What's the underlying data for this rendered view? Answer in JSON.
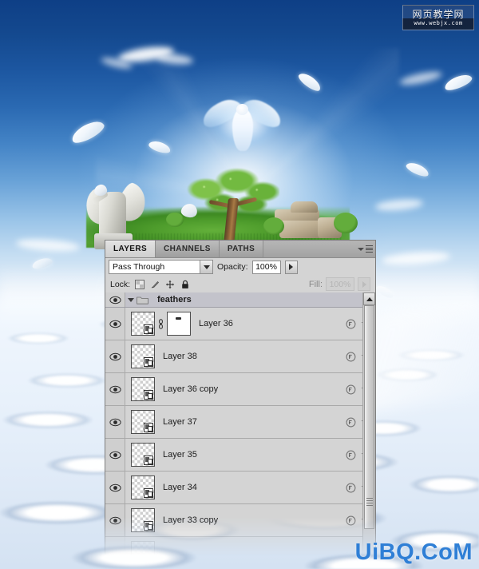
{
  "artwork": {
    "description": "Photo composite: blue sky, glowing white dove, floating feathers, angel statue, bonsai tree, stone ruins, sea of clouds",
    "sky_top_color": "#0e3f86",
    "cloud_color": "#eef5fd",
    "grass_color": "#4f9a2c"
  },
  "panel": {
    "tabs": [
      {
        "label": "LAYERS",
        "active": true
      },
      {
        "label": "CHANNELS",
        "active": false
      },
      {
        "label": "PATHS",
        "active": false
      }
    ],
    "menu_icon": "panel-menu-icon",
    "blend_mode": "Pass Through",
    "blend_dropdown_icon": "chevron-down-icon",
    "opacity_label": "Opacity:",
    "opacity_value": "100%",
    "opacity_spinner_icon": "triangle-right-icon",
    "lock_label": "Lock:",
    "lock_buttons": [
      {
        "name": "lock-transparent-pixels",
        "icon": "checkerboard-icon"
      },
      {
        "name": "lock-image-pixels",
        "icon": "brush-icon"
      },
      {
        "name": "lock-position",
        "icon": "move-icon"
      },
      {
        "name": "lock-all",
        "icon": "lock-icon"
      }
    ],
    "fill_label": "Fill:",
    "fill_value": "100%",
    "fill_disabled": true,
    "scrollbar": {
      "up_arrow_icon": "triangle-up-icon",
      "grip_icon": "grip-lines-icon"
    }
  },
  "layers": [
    {
      "name": "feathers",
      "type": "group",
      "visible": true,
      "expanded": true,
      "selected": true,
      "has_mask": false,
      "has_fx": false
    },
    {
      "name": "Layer 36",
      "type": "layer",
      "visible": true,
      "has_mask": true,
      "linked": true,
      "has_fx": true
    },
    {
      "name": "Layer 38",
      "type": "layer",
      "visible": true,
      "has_mask": false,
      "has_fx": true
    },
    {
      "name": "Layer 36 copy",
      "type": "layer",
      "visible": true,
      "has_mask": false,
      "has_fx": true
    },
    {
      "name": "Layer 37",
      "type": "layer",
      "visible": true,
      "has_mask": false,
      "has_fx": true
    },
    {
      "name": "Layer 35",
      "type": "layer",
      "visible": true,
      "has_mask": false,
      "has_fx": true
    },
    {
      "name": "Layer 34",
      "type": "layer",
      "visible": true,
      "has_mask": false,
      "has_fx": true
    },
    {
      "name": "Layer 33 copy",
      "type": "layer",
      "visible": true,
      "has_mask": false,
      "has_fx": true
    }
  ],
  "watermarks": {
    "top_right_cn": "网页教学网",
    "top_right_url": "www.webjx.com",
    "bottom_right": "UiBQ.CoM",
    "bottom_right_color": "#2f7fd6"
  }
}
